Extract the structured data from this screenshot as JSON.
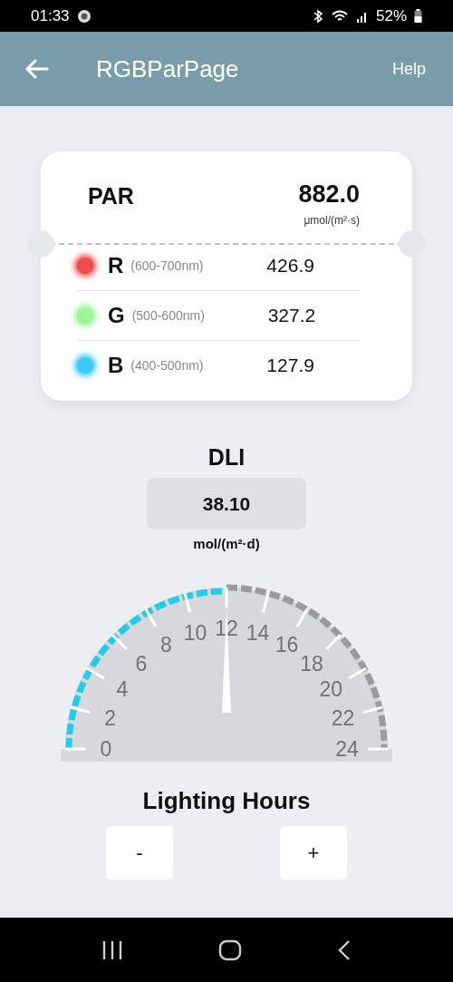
{
  "status_bar": {
    "time": "01:33",
    "battery": "52%"
  },
  "app_bar": {
    "title": "RGBParPage",
    "action": "Help"
  },
  "par": {
    "label": "PAR",
    "value": "882.0",
    "unit": "μmol/(m²·s)"
  },
  "channels": [
    {
      "letter": "R",
      "range": "(600-700nm)",
      "value": "426.9",
      "color": "#f24a4a"
    },
    {
      "letter": "G",
      "range": "(500-600nm)",
      "value": "327.2",
      "color": "#9ef59a"
    },
    {
      "letter": "B",
      "range": "(400-500nm)",
      "value": "127.9",
      "color": "#3ccaf5"
    }
  ],
  "dli": {
    "title": "DLI",
    "value": "38.10",
    "unit": "mol/(m²·d)"
  },
  "gauge": {
    "labels": [
      "0",
      "2",
      "4",
      "6",
      "8",
      "10",
      "12",
      "14",
      "16",
      "18",
      "20",
      "22",
      "24"
    ]
  },
  "lighting_hours": {
    "title": "Lighting Hours",
    "buttons": [
      "-",
      "+"
    ]
  }
}
